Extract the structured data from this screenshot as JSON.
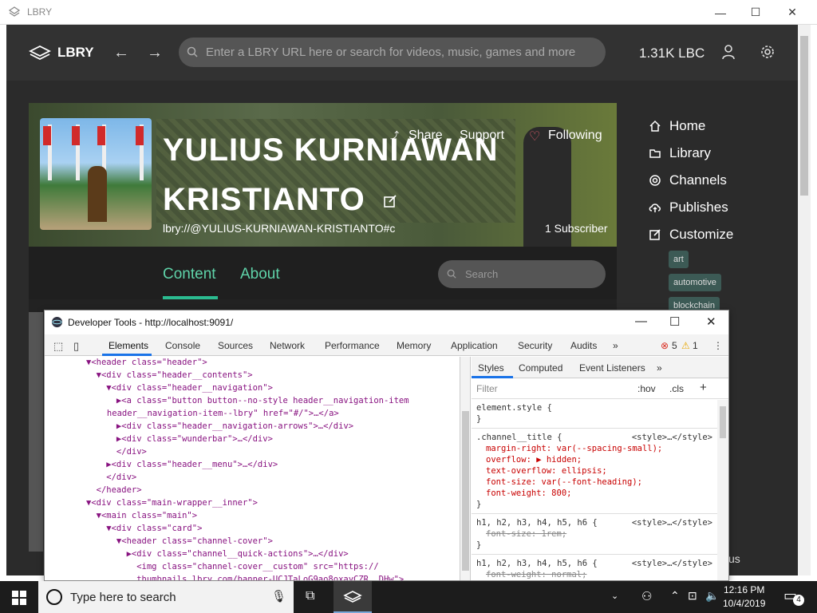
{
  "window": {
    "title": "LBRY"
  },
  "header": {
    "logo_text": "LBRY",
    "search_placeholder": "Enter a LBRY URL here or search for videos, music, games and more",
    "balance": "1.31K LBC"
  },
  "channel": {
    "title": "YULIUS KURNIAWAN KRISTIANTO",
    "quick_actions": {
      "share": "Share",
      "support": "Support",
      "following": "Following"
    },
    "claim_url": "lbry://@YULIUS-KURNIAWAN-KRISTIANTO#c",
    "subscribers": "1 Subscriber",
    "tabs": [
      "Content",
      "About"
    ],
    "search_placeholder": "Search"
  },
  "sidebar": {
    "items": [
      {
        "label": "Home",
        "icon": "home-icon"
      },
      {
        "label": "Library",
        "icon": "folder-icon"
      },
      {
        "label": "Channels",
        "icon": "at-icon"
      },
      {
        "label": "Publishes",
        "icon": "cloud-upload-icon"
      },
      {
        "label": "Customize",
        "icon": "edit-icon"
      }
    ],
    "tags": [
      "art",
      "automotive",
      "blockchain"
    ],
    "partial_label": "us"
  },
  "devtools": {
    "title": "Developer Tools - http://localhost:9091/",
    "tabs": [
      "Elements",
      "Console",
      "Sources",
      "Network",
      "Performance",
      "Memory",
      "Application",
      "Security",
      "Audits"
    ],
    "errors": "5",
    "warnings": "1",
    "styles_tabs": [
      "Styles",
      "Computed",
      "Event Listeners"
    ],
    "filter_placeholder": "Filter",
    "hov": ":hov",
    "cls": ".cls",
    "element_lines": [
      "▼<header class=\"header\">",
      "  ▼<div class=\"header__contents\">",
      "    ▼<div class=\"header__navigation\">",
      "      ▶<a class=\"button button--no-style header__navigation-item",
      "      header__navigation-item--lbry\" href=\"#/\">…</a>",
      "      ▶<div class=\"header__navigation-arrows\">…</div>",
      "      ▶<div class=\"wunderbar\">…</div>",
      "      </div>",
      "    ▶<div class=\"header__menu\">…</div>",
      "    </div>",
      "  </header>",
      "▼<div class=\"main-wrapper__inner\">",
      "  ▼<main class=\"main\">",
      "    ▼<div class=\"card\">",
      "      ▼<header class=\"channel-cover\">",
      "        ▶<div class=\"channel__quick-actions\">…</div>",
      "          <img class=\"channel-cover__custom\" src=\"https://",
      "          thumbnails.lbry.com/banner-UCJTaLoG9ao8oxayCZR__DHw\">"
    ],
    "rules": {
      "element_style": "element.style {",
      "close": "}",
      "channel_title": {
        "selector": ".channel__title {",
        "source": "<style>…</style>",
        "props": [
          "margin-right: var(--spacing-small);",
          "overflow: ▶ hidden;",
          "text-overflow: ellipsis;",
          "font-size: var(--font-heading);",
          "font-weight: 800;"
        ]
      },
      "headings1": {
        "selector": "h1, h2, h3, h4, h5, h6 {",
        "source": "<style>…</style>",
        "prop": "font-size: 1rem;"
      },
      "headings2": {
        "selector": "h1, h2, h3, h4, h5, h6 {",
        "source": "<style>…</style>",
        "prop": "font-weight: normal;"
      }
    }
  },
  "taskbar": {
    "search_placeholder": "Type here to search",
    "time": "12:16 PM",
    "date": "10/4/2019",
    "notifications": "4"
  }
}
